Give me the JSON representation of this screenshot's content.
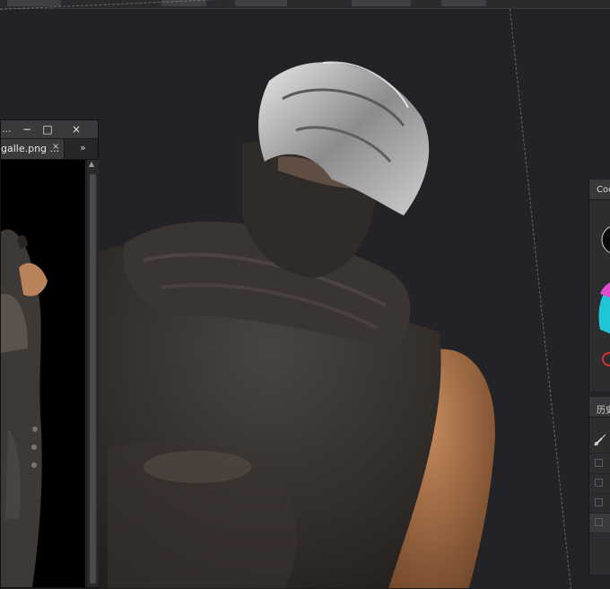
{
  "document_window": {
    "title": "...",
    "tab_label": "galle.png ...",
    "tab_close": "×",
    "overflow": "»",
    "minimize": "−",
    "maximize": "□",
    "close": "×"
  },
  "color_panel": {
    "title": "Coo"
  },
  "history_panel": {
    "title": "历史"
  },
  "icons": {
    "brush": "brush-icon",
    "scroll_up": "scroll-up-arrow-icon"
  }
}
